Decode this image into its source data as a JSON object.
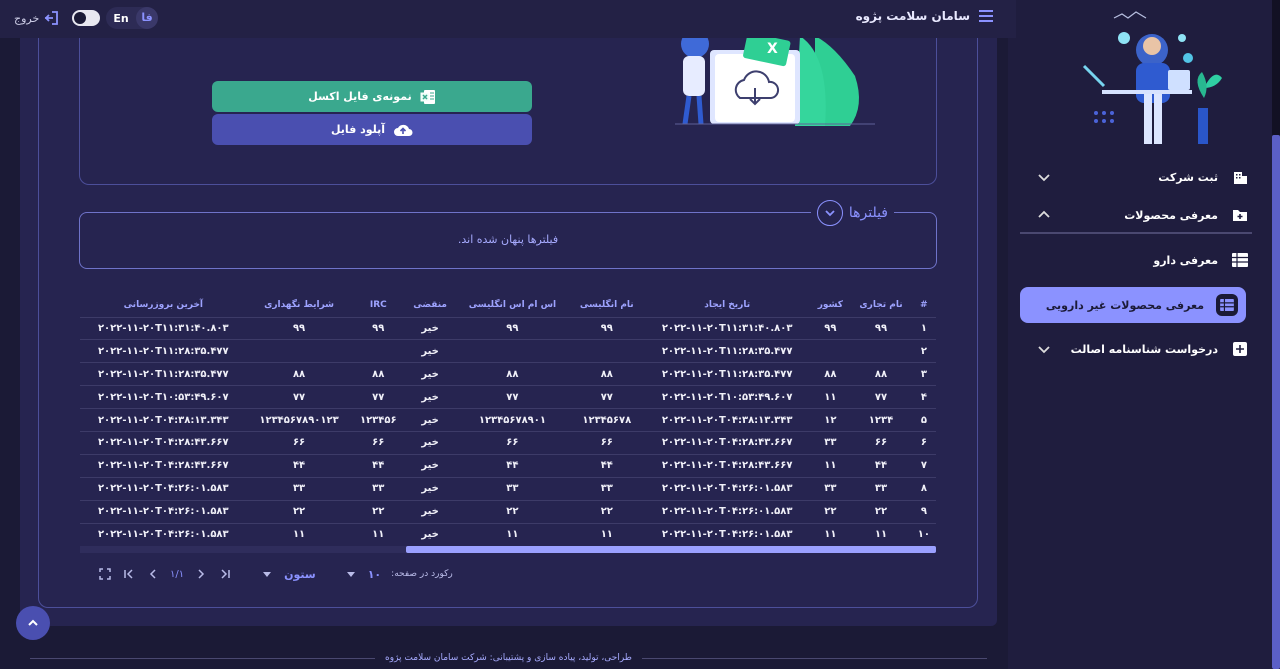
{
  "header": {
    "brand": "سامان سلامت پژوه",
    "logout_label": "خروج",
    "lang_en": "En",
    "lang_fa": "فا"
  },
  "sidebar": {
    "items": [
      {
        "label": "ثبت شرکت",
        "icon": "building-icon",
        "expanded": false
      },
      {
        "label": "معرفی محصولات",
        "icon": "folder-add-icon",
        "expanded": true
      },
      {
        "label": "معرفی دارو",
        "icon": "list-icon"
      },
      {
        "label": "معرفی محصولات غیر دارویی",
        "icon": "list-icon",
        "active": true
      },
      {
        "label": "درخواست شناسنامه اصالت",
        "icon": "doc-add-icon",
        "expanded": false
      }
    ]
  },
  "upload": {
    "excel_button": "نمونه‌ی فایل اکسل",
    "upload_button": "آپلود فایل"
  },
  "filters": {
    "title": "فیلترها",
    "message": "فیلترها پنهان شده اند."
  },
  "table": {
    "columns": [
      "#",
      "نام تجاری",
      "کشور",
      "تاریخ ایجاد",
      "نام انگلیسی",
      "اس ام اس انگلیسی",
      "منقضی",
      "IRC",
      "شرایط نگهداری",
      "آخرین بروزرسانی"
    ],
    "rows": [
      [
        "۱",
        "۹۹",
        "۹۹",
        "۲۰۲۲-۱۱-۲۰T۱۱:۳۱:۴۰.۸۰۳",
        "۹۹",
        "۹۹",
        "خیر",
        "۹۹",
        "۹۹",
        "۲۰۲۲-۱۱-۲۰T۱۱:۳۱:۴۰.۸۰۳"
      ],
      [
        "۲",
        "",
        "",
        "۲۰۲۲-۱۱-۲۰T۱۱:۲۸:۳۵.۴۷۷",
        "",
        "",
        "خیر",
        "",
        "",
        "۲۰۲۲-۱۱-۲۰T۱۱:۲۸:۳۵.۴۷۷"
      ],
      [
        "۳",
        "۸۸",
        "۸۸",
        "۲۰۲۲-۱۱-۲۰T۱۱:۲۸:۳۵.۴۷۷",
        "۸۸",
        "۸۸",
        "خیر",
        "۸۸",
        "۸۸",
        "۲۰۲۲-۱۱-۲۰T۱۱:۲۸:۳۵.۴۷۷"
      ],
      [
        "۴",
        "۷۷",
        "۱۱",
        "۲۰۲۲-۱۱-۲۰T۱۰:۵۳:۴۹.۶۰۷",
        "۷۷",
        "۷۷",
        "خیر",
        "۷۷",
        "۷۷",
        "۲۰۲۲-۱۱-۲۰T۱۰:۵۳:۴۹.۶۰۷"
      ],
      [
        "۵",
        "۱۲۳۴",
        "۱۲",
        "۲۰۲۲-۱۱-۲۰T۰۴:۳۸:۱۳.۳۴۳",
        "۱۲۳۴۵۶۷۸",
        "۱۲۳۴۵۶۷۸۹۰۱",
        "خیر",
        "۱۲۳۴۵۶",
        "۱۲۳۴۵۶۷۸۹۰۱۲۳",
        "۲۰۲۲-۱۱-۲۰T۰۴:۳۸:۱۳.۳۴۳"
      ],
      [
        "۶",
        "۶۶",
        "۳۳",
        "۲۰۲۲-۱۱-۲۰T۰۴:۲۸:۴۳.۶۶۷",
        "۶۶",
        "۶۶",
        "خیر",
        "۶۶",
        "۶۶",
        "۲۰۲۲-۱۱-۲۰T۰۴:۲۸:۴۳.۶۶۷"
      ],
      [
        "۷",
        "۴۴",
        "۱۱",
        "۲۰۲۲-۱۱-۲۰T۰۴:۲۸:۴۳.۶۶۷",
        "۴۴",
        "۴۴",
        "خیر",
        "۴۴",
        "۴۴",
        "۲۰۲۲-۱۱-۲۰T۰۴:۲۸:۴۳.۶۶۷"
      ],
      [
        "۸",
        "۳۳",
        "۳۳",
        "۲۰۲۲-۱۱-۲۰T۰۴:۲۶:۰۱.۵۸۳",
        "۳۳",
        "۳۳",
        "خیر",
        "۳۳",
        "۳۳",
        "۲۰۲۲-۱۱-۲۰T۰۴:۲۶:۰۱.۵۸۳"
      ],
      [
        "۹",
        "۲۲",
        "۲۲",
        "۲۰۲۲-۱۱-۲۰T۰۴:۲۶:۰۱.۵۸۳",
        "۲۲",
        "۲۲",
        "خیر",
        "۲۲",
        "۲۲",
        "۲۰۲۲-۱۱-۲۰T۰۴:۲۶:۰۱.۵۸۳"
      ],
      [
        "۱۰",
        "۱۱",
        "۱۱",
        "۲۰۲۲-۱۱-۲۰T۰۴:۲۶:۰۱.۵۸۳",
        "۱۱",
        "۱۱",
        "خیر",
        "۱۱",
        "۱۱",
        "۲۰۲۲-۱۱-۲۰T۰۴:۲۶:۰۱.۵۸۳"
      ]
    ]
  },
  "pagination": {
    "rows_label": "رکورد در صفحه:",
    "rows_value": "۱۰",
    "columns_label": "ستون",
    "page_text": "۱/۱"
  },
  "footer": {
    "text": "طراحی، تولید، پیاده سازی و پشتیبانی: شرکت سامان سلامت پژوه"
  },
  "colors": {
    "accent": "#8b92ff",
    "excel_button": "#3aa88e",
    "upload_button": "#4a4fb0",
    "background": "#1b1a36"
  }
}
